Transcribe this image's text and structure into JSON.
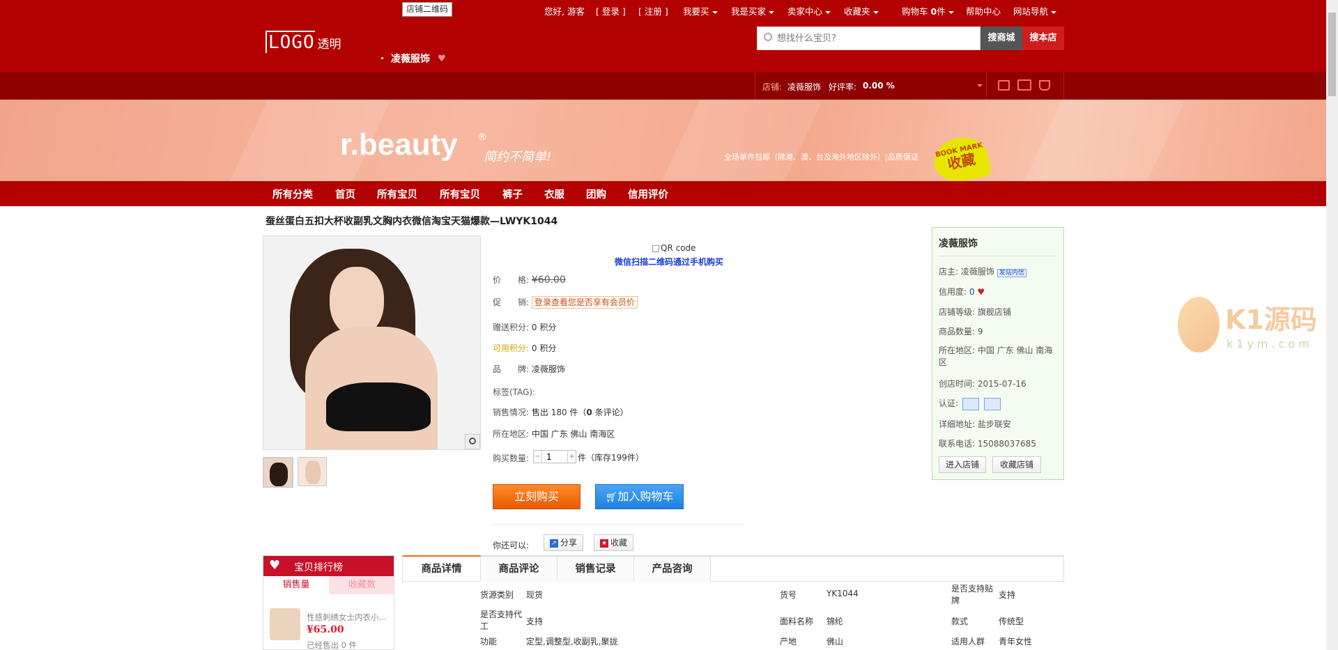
{
  "topbar": {
    "store_qr_label": "店铺二维码",
    "greeting": "您好, 游客",
    "login": "[ 登录 ]",
    "register": "[ 注册 ]",
    "i_want_buy": "我要买",
    "i_am_buyer": "我是买家",
    "seller_center": "卖家中心",
    "favorites": "收藏夹",
    "cart_prefix": "购物车",
    "cart_count": "0",
    "cart_unit": "件",
    "help": "帮助中心",
    "site_nav": "网站导航"
  },
  "header": {
    "logo_text": "LOGO",
    "logo_suffix": "透明",
    "store_name": "凌薇服饰",
    "search_placeholder": "想找什么宝贝?",
    "search_mall": "搜商城",
    "search_store": "搜本店"
  },
  "subbar": {
    "store_label": "店铺:",
    "store_name": "凌薇服饰",
    "rating_label": "好评率:",
    "rating_value": "0.00 %"
  },
  "banner": {
    "brand": "r.beauty",
    "reg": "®",
    "slogan": "简约不简单!",
    "shipping": "全场单件包邮（除港、澳、台及海外地区除外）|品质保证",
    "bookmark_en": "BOOK MARK",
    "bookmark_cn": "收藏"
  },
  "nav": [
    "所有分类",
    "首页",
    "所有宝贝",
    "所有宝贝",
    "裤子",
    "衣服",
    "团购",
    "信用评价"
  ],
  "product": {
    "title": "蚕丝蛋白五扣大杯收副乳文胸内衣微信淘宝天猫爆款—LWYK1044",
    "qr_alt": "QR code",
    "qr_text": "微信扫描二维码通过手机购买",
    "price_label": "价　　格:",
    "price": "¥60.00",
    "promo_label": "促　　销:",
    "promo_text": "登录查看您是否享有会员价",
    "points_gift_label": "赠送积分:",
    "points_gift": "0 积分",
    "points_avail_label": "可用积分:",
    "points_avail": "0 积分",
    "brand_label": "品　　牌:",
    "brand": "凌薇服饰",
    "tags_label": "标签(TAG):",
    "sales_label": "销售情况:",
    "sales_text": "售出 180 件（",
    "reviews_count": "0",
    "reviews_suffix": " 条评论）",
    "location_label": "所在地区:",
    "location": "中国 广东 佛山 南海区",
    "qty_label": "购买数量:",
    "qty_value": "1",
    "qty_minus": "−",
    "qty_plus": "+",
    "stock_text": "件（库存199件）",
    "buy_now": "立刻购买",
    "add_cart": "加入购物车",
    "also_label": "你还可以:",
    "share": "分享",
    "collect": "收藏"
  },
  "shop": {
    "name": "凌薇服饰",
    "owner_label": "店主:",
    "owner": "凌薇服饰",
    "contact_badge": "发站内信",
    "credit_label": "信用度:",
    "credit": "0",
    "level_label": "店铺等级:",
    "level": "旗舰店铺",
    "count_label": "商品数量:",
    "count": "9",
    "region_label": "所在地区:",
    "region": "中国 广东 佛山 南海区",
    "created_label": "创店时间:",
    "created": "2015-07-16",
    "cert_label": "认证:",
    "address_label": "详细地址:",
    "address": "盐步联安",
    "phone_label": "联系电话:",
    "phone": "15088037685",
    "enter_btn": "进入店铺",
    "fav_btn": "收藏店铺"
  },
  "ranking": {
    "title": "宝贝排行榜",
    "tab_sales": "销售量",
    "tab_fav": "收藏数",
    "item_name": "性感刺绣女士内衣小...",
    "item_price": "¥65.00",
    "item_sold": "已经售出 0 件"
  },
  "tabs": [
    "商品详情",
    "商品评论",
    "销售记录",
    "产品咨询"
  ],
  "specs": [
    {
      "k": "货源类别",
      "v": "现货"
    },
    {
      "k": "货号",
      "v": "YK1044"
    },
    {
      "k": "是否支持贴牌",
      "v": "支持"
    },
    {
      "k": "是否支持代工",
      "v": "支持"
    },
    {
      "k": "面料名称",
      "v": "锦纶"
    },
    {
      "k": "款式",
      "v": "传统型"
    },
    {
      "k": "功能",
      "v": "定型,调整型,收副乳,聚拢"
    },
    {
      "k": "产地",
      "v": "佛山"
    },
    {
      "k": "适用人群",
      "v": "青年女性"
    }
  ],
  "watermark": {
    "brand": "K1源码",
    "domain": "k1ym.com"
  },
  "colors": {
    "primary": "#b30000",
    "dark": "#8f0000",
    "buy": "#f06a0a",
    "cart": "#2f8fe6"
  }
}
